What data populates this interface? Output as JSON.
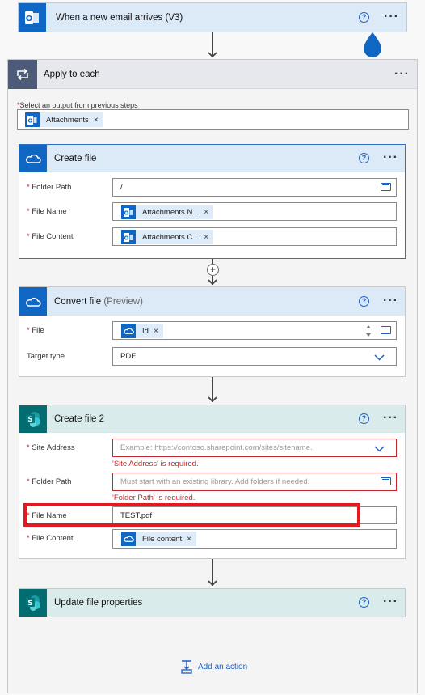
{
  "trigger": {
    "title": "When a new email arrives (V3)",
    "icon": "outlook-icon",
    "color": "#0f67c3",
    "header_bg": "#dce9f7"
  },
  "apply_each": {
    "title": "Apply to each",
    "select_label": "Select an output from previous steps",
    "token": "Attachments",
    "header_bg": "#e6e8ee",
    "icon_bg": "#4d5a78"
  },
  "create_file": {
    "title": "Create file",
    "fields": [
      {
        "label": "Folder Path",
        "value": "/"
      },
      {
        "label": "File Name",
        "token": "Attachments N..."
      },
      {
        "label": "File Content",
        "token": "Attachments C..."
      }
    ]
  },
  "convert_file": {
    "title": "Convert file",
    "title_sub": "(Preview)",
    "fields": [
      {
        "label": "File",
        "token": "Id"
      },
      {
        "label": "Target type",
        "value": "PDF"
      }
    ]
  },
  "create_file2": {
    "title": "Create file 2",
    "header_bg": "#d9ebea",
    "icon_bg": "#036c70",
    "fields": [
      {
        "label": "Site Address",
        "placeholder": "Example: https://contoso.sharepoint.com/sites/sitename.",
        "error": "'Site Address' is required."
      },
      {
        "label": "Folder Path",
        "placeholder": "Must start with an existing library. Add folders if needed.",
        "error": "'Folder Path' is required."
      },
      {
        "label": "File Name",
        "value": "TEST.pdf"
      },
      {
        "label": "File Content",
        "token": "File content"
      }
    ]
  },
  "update_props": {
    "title": "Update file properties"
  },
  "add_action": "Add an action",
  "token_remove": "×",
  "required_mark": "*",
  "more_label": "···",
  "help_label": "?",
  "plus_label": "+"
}
